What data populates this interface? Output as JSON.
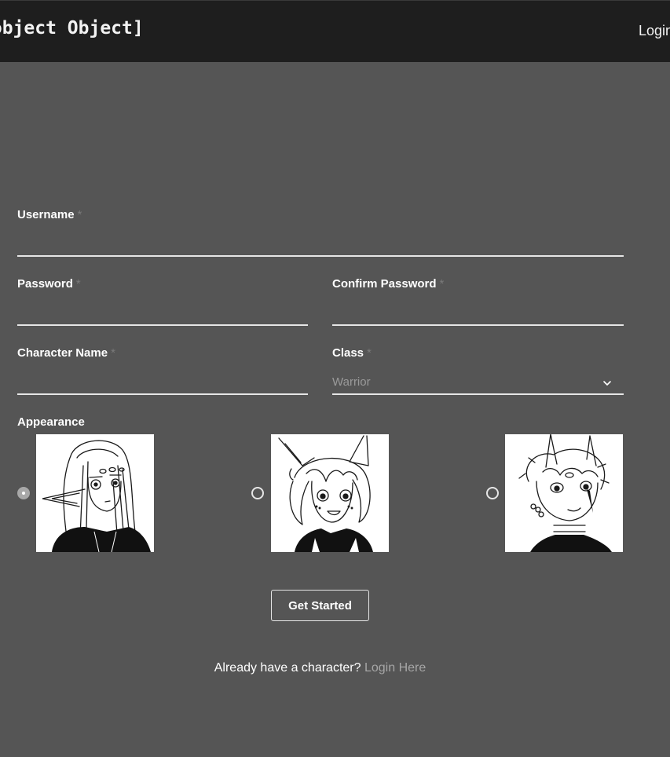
{
  "header": {
    "title": "[object Object]",
    "login_label": "Login"
  },
  "form": {
    "username": {
      "label": "Username",
      "required_mark": "*",
      "value": ""
    },
    "password": {
      "label": "Password",
      "required_mark": "*",
      "value": ""
    },
    "confirm_password": {
      "label": "Confirm Password",
      "required_mark": "*",
      "value": ""
    },
    "character_name": {
      "label": "Character Name",
      "required_mark": "*",
      "value": ""
    },
    "class": {
      "label": "Class",
      "required_mark": "*",
      "selected": "Warrior"
    },
    "appearance": {
      "label": "Appearance",
      "options": [
        {
          "name": "elf-girl-portrait",
          "selected": true
        },
        {
          "name": "cat-girl-portrait",
          "selected": false
        },
        {
          "name": "horned-boy-portrait",
          "selected": false
        }
      ]
    },
    "submit_label": "Get Started"
  },
  "footer": {
    "prompt": "Already have a character?",
    "link_label": "Login Here"
  },
  "colors": {
    "background": "#555555",
    "topbar": "#1e1e1e",
    "underline": "#e6e6e6",
    "link": "#a6a6a6"
  }
}
